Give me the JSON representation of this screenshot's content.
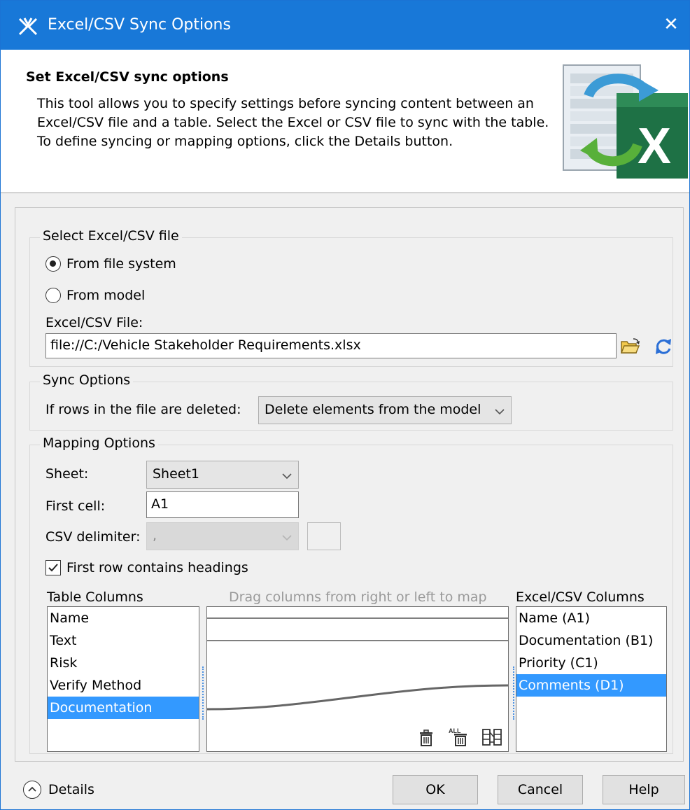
{
  "window": {
    "title": "Excel/CSV Sync Options",
    "close_glyph": "✕"
  },
  "header": {
    "title": "Set Excel/CSV sync options",
    "description": "This tool allows you to specify settings before syncing content between an Excel/CSV file and a table. Select the Excel or CSV file to sync with the table. To define syncing or mapping options, click the Details button."
  },
  "select_file": {
    "legend": "Select Excel/CSV file",
    "radio_file_system": "From file system",
    "radio_model": "From model",
    "selected": "From file system",
    "file_label": "Excel/CSV File:",
    "file_value": "file://C:/Vehicle Stakeholder Requirements.xlsx"
  },
  "sync_options": {
    "legend": "Sync Options",
    "deleted_label": "If rows in the file are deleted:",
    "deleted_value": "Delete elements from the model"
  },
  "mapping": {
    "legend": "Mapping Options",
    "sheet_label": "Sheet:",
    "sheet_value": "Sheet1",
    "first_cell_label": "First cell:",
    "first_cell_value": "A1",
    "csv_delimiter_label": "CSV delimiter:",
    "csv_delimiter_value": ",",
    "first_row_headings_label": "First row contains headings",
    "first_row_headings_checked": true,
    "table_columns_label": "Table Columns",
    "excel_columns_label": "Excel/CSV Columns",
    "drag_hint": "Drag columns from right or left to map",
    "table_columns": [
      "Name",
      "Text",
      "Risk",
      "Verify Method",
      "Documentation"
    ],
    "table_selected": "Documentation",
    "excel_columns": [
      "Name (A1)",
      "Documentation (B1)",
      "Priority (C1)",
      "Comments (D1)"
    ],
    "excel_selected": "Comments (D1)"
  },
  "footer": {
    "details_label": "Details",
    "ok_label": "OK",
    "cancel_label": "Cancel",
    "help_label": "Help"
  },
  "colors": {
    "titlebar": "#1878d8",
    "selection": "#3399ff",
    "excel_green": "#1e7145"
  }
}
